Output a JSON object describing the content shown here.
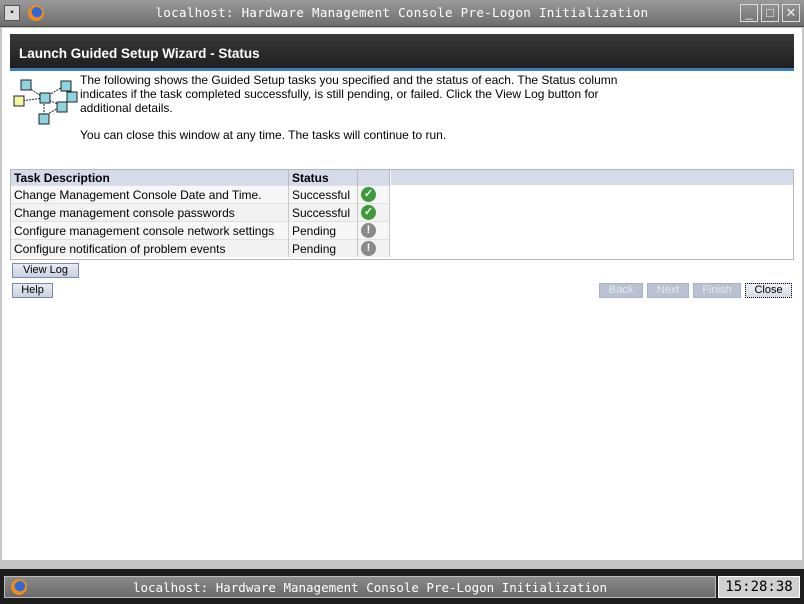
{
  "window": {
    "title": "localhost: Hardware Management Console Pre-Logon Initialization"
  },
  "page": {
    "heading": "Launch Guided Setup Wizard - Status",
    "intro": "The following shows the Guided Setup tasks you specified and the status of each. The Status column indicates if the task completed successfully, is still pending, or failed. Click the View Log button for additional details.",
    "note": "You can close this window at any time. The tasks will continue to run."
  },
  "table": {
    "headers": [
      "Task Description",
      "Status",
      ""
    ],
    "rows": [
      {
        "task": "Change Management Console Date and Time.",
        "status": "Successful",
        "icon": "check-icon"
      },
      {
        "task": "Change management console passwords",
        "status": "Successful",
        "icon": "check-icon"
      },
      {
        "task": "Configure management console network settings",
        "status": "Pending",
        "icon": "exclamation-icon"
      },
      {
        "task": "Configure notification of problem events",
        "status": "Pending",
        "icon": "exclamation-icon"
      }
    ]
  },
  "buttons": {
    "view_log": "View Log",
    "help": "Help",
    "back": "Back",
    "next": "Next",
    "finish": "Finish",
    "close": "Close"
  },
  "taskbar": {
    "task_title": "localhost: Hardware Management Console Pre-Logon Initialization",
    "clock": "15:28:38"
  },
  "colors": {
    "header_bg": "#2a2a2a",
    "accent_line": "#3c7fb8",
    "success": "#3c9a3c",
    "pending": "#8a8a8a"
  }
}
